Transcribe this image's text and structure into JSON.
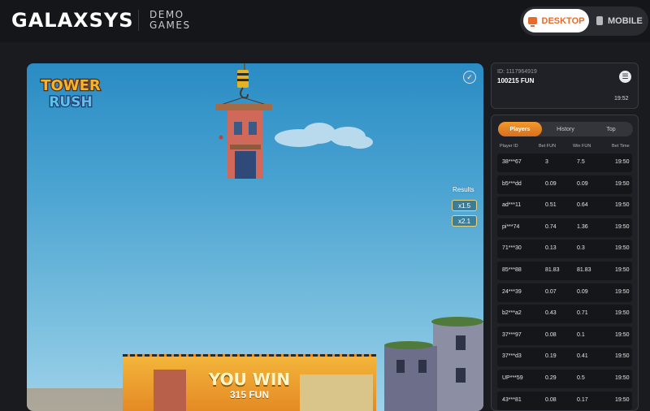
{
  "header": {
    "logo": "GALAXSYS",
    "demo_line1": "DEMO",
    "demo_line2": "GAMES",
    "desktop_label": "DESKTOP",
    "mobile_label": "MOBILE"
  },
  "game": {
    "logo_line1": "TOWER",
    "logo_line2": "RUSH",
    "results_label": "Results",
    "results": [
      "x1.5",
      "x2.1"
    ],
    "win_title": "YOU WIN",
    "win_amount": "315 FUN"
  },
  "account": {
    "id_text": "ID: 1117964919",
    "balance": "100215 FUN",
    "time": "19:52"
  },
  "bets": {
    "tabs": [
      "Players",
      "History",
      "Top"
    ],
    "columns": [
      "Player ID",
      "Bet  FUN",
      "Win  FUN",
      "Bet Time"
    ],
    "rows": [
      [
        "38***67",
        "3",
        "7.5",
        "19:50"
      ],
      [
        "b5***dd",
        "0.09",
        "0.09",
        "19:50"
      ],
      [
        "ad***11",
        "0.51",
        "0.64",
        "19:50"
      ],
      [
        "pi***74",
        "0.74",
        "1.36",
        "19:50"
      ],
      [
        "71***30",
        "0.13",
        "0.3",
        "19:50"
      ],
      [
        "85***88",
        "81.83",
        "81.83",
        "19:50"
      ],
      [
        "24***39",
        "0.07",
        "0.09",
        "19:50"
      ],
      [
        "b2***a2",
        "0.43",
        "0.71",
        "19:50"
      ],
      [
        "37***97",
        "0.08",
        "0.1",
        "19:50"
      ],
      [
        "37***d3",
        "0.19",
        "0.41",
        "19:50"
      ],
      [
        "UP***59",
        "0.29",
        "0.5",
        "19:50"
      ],
      [
        "43***81",
        "0.08",
        "0.17",
        "19:50"
      ]
    ]
  },
  "colors": {
    "accent": "#e86a2a",
    "tab_active": "#f29a2e",
    "sky": "#4aa3d1"
  }
}
